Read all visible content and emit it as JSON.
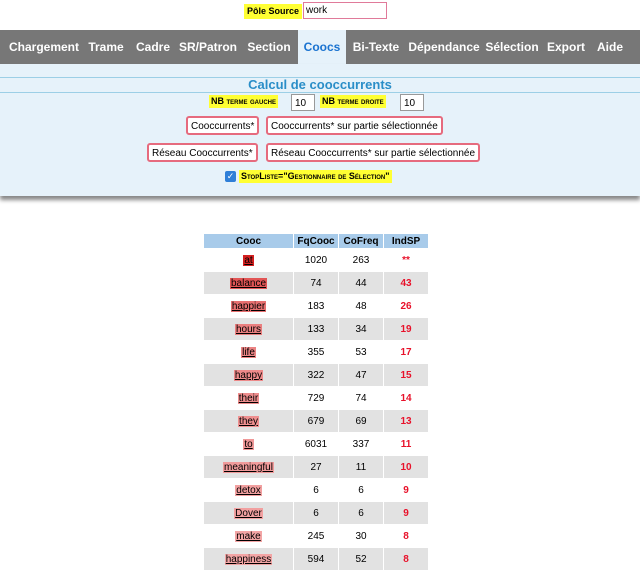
{
  "source": {
    "label": "Pôle Source",
    "value": "work"
  },
  "nav": {
    "items": [
      {
        "label": "Chargement",
        "active": false
      },
      {
        "label": "Trame",
        "active": false
      },
      {
        "label": "Cadre",
        "active": false
      },
      {
        "label": "SR/Patron",
        "active": false
      },
      {
        "label": "Section",
        "active": false
      },
      {
        "label": "Coocs",
        "active": true
      },
      {
        "label": "Bi-Texte",
        "active": false
      },
      {
        "label": "Dépendance",
        "active": false
      },
      {
        "label": "Sélection",
        "active": false
      },
      {
        "label": "Export",
        "active": false
      },
      {
        "label": "Aide",
        "active": false
      }
    ]
  },
  "panel": {
    "title": "Calcul de cooccurrents",
    "left_label": "NB terme gauche",
    "left_value": "10",
    "right_label": "NB terme droite",
    "right_value": "10",
    "btn_cooc": "Cooccurrents*",
    "btn_cooc_sel": "Cooccurrents* sur partie sélectionnée",
    "btn_network": "Réseau Cooccurrents*",
    "btn_network_sel": "Réseau Cooccurrents* sur partie sélectionnée",
    "stoplist_label": "StopListe=\"Gestionnaire de Sélection\"",
    "stoplist_checked": true
  },
  "table": {
    "headers": [
      "Cooc",
      "FqCooc",
      "CoFreq",
      "IndSP"
    ],
    "rows": [
      {
        "word": "at",
        "fq": "1020",
        "cofreq": "263",
        "ind": "**",
        "color": "#d42020"
      },
      {
        "word": "balance",
        "fq": "74",
        "cofreq": "44",
        "ind": "43",
        "color": "#e25555"
      },
      {
        "word": "happier",
        "fq": "183",
        "cofreq": "48",
        "ind": "26",
        "color": "#e77070"
      },
      {
        "word": "hours",
        "fq": "133",
        "cofreq": "34",
        "ind": "19",
        "color": "#ea7f7f"
      },
      {
        "word": "life",
        "fq": "355",
        "cofreq": "53",
        "ind": "17",
        "color": "#ec8484"
      },
      {
        "word": "happy",
        "fq": "322",
        "cofreq": "47",
        "ind": "15",
        "color": "#ed8a8a"
      },
      {
        "word": "their",
        "fq": "729",
        "cofreq": "74",
        "ind": "14",
        "color": "#ee8d8d"
      },
      {
        "word": "they",
        "fq": "679",
        "cofreq": "69",
        "ind": "13",
        "color": "#ef9090"
      },
      {
        "word": "to",
        "fq": "6031",
        "cofreq": "337",
        "ind": "11",
        "color": "#f09898"
      },
      {
        "word": "meaningful",
        "fq": "27",
        "cofreq": "11",
        "ind": "10",
        "color": "#f19b9b"
      },
      {
        "word": "detox",
        "fq": "6",
        "cofreq": "6",
        "ind": "9",
        "color": "#f2a0a0"
      },
      {
        "word": "Dover",
        "fq": "6",
        "cofreq": "6",
        "ind": "9",
        "color": "#f2a0a0"
      },
      {
        "word": "make",
        "fq": "245",
        "cofreq": "30",
        "ind": "8",
        "color": "#f3a5a5"
      },
      {
        "word": "happiness",
        "fq": "594",
        "cofreq": "52",
        "ind": "8",
        "color": "#f3a5a5"
      }
    ]
  }
}
